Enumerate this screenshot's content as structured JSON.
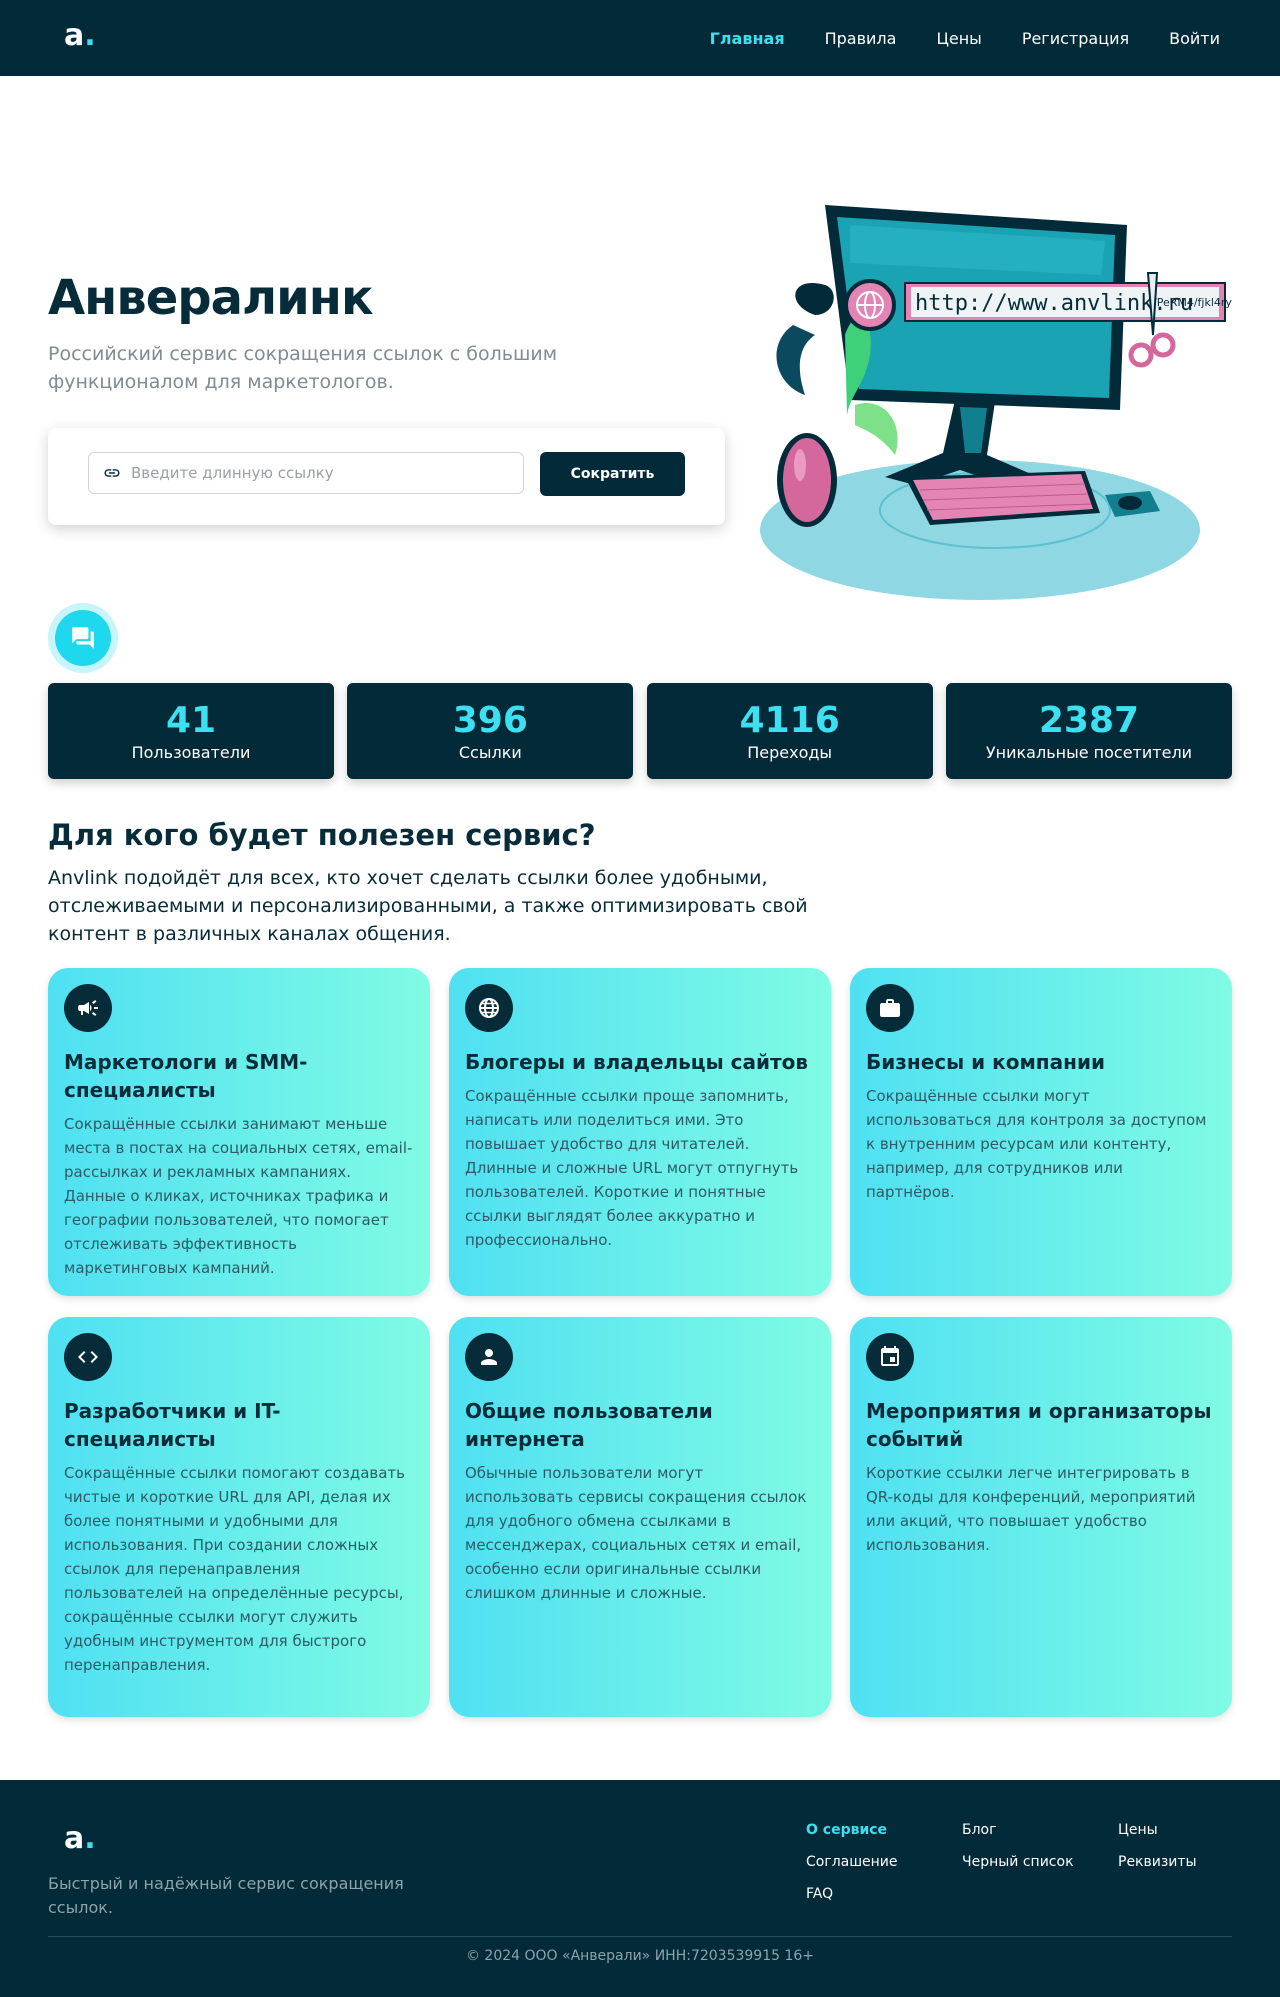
{
  "nav": {
    "logo_letter": "a",
    "logo_dot": ".",
    "links": [
      "Главная",
      "Правила",
      "Цены",
      "Регистрация",
      "Войти"
    ]
  },
  "hero": {
    "title": "Анвералинк",
    "subtitle": "Российский сервис сокращения ссылок с большим функционалом для маркетологов.",
    "input_placeholder": "Введите длинную ссылку",
    "button_label": "Сократить",
    "illustration_url_text": "http://www.anvlink.ru",
    "illustration_url_tail": "/PeRM4/fjkl4ry"
  },
  "stats": [
    {
      "value": "41",
      "label": "Пользователи"
    },
    {
      "value": "396",
      "label": "Ссылки"
    },
    {
      "value": "4116",
      "label": "Переходы"
    },
    {
      "value": "2387",
      "label": "Уникальные посетители"
    }
  ],
  "audience": {
    "title": "Для кого будет полезен сервис?",
    "description": "Anvlink подойдёт для всех, кто хочет сделать ссылки более удобными, отслеживаемыми и персонализированными, а также оптимизировать свой контент в различных каналах общения.",
    "cards": [
      {
        "icon": "megaphone-icon",
        "title": "Маркетологи и SMM-специалисты",
        "text": "Сокращённые ссылки занимают меньше места в постах на социальных сетях, email-рассылках и рекламных кампаниях. Данные о кликах, источниках трафика и географии пользователей, что помогает отслеживать эффективность маркетинговых кампаний."
      },
      {
        "icon": "globe-icon",
        "title": "Блогеры и владельцы сайтов",
        "text": "Сокращённые ссылки проще запомнить, написать или поделиться ими. Это повышает удобство для читателей. Длинные и сложные URL могут отпугнуть пользователей. Короткие и понятные ссылки выглядят более аккуратно и профессионально."
      },
      {
        "icon": "briefcase-icon",
        "title": "Бизнесы и компании",
        "text": "Сокращённые ссылки могут использоваться для контроля за доступом к внутренним ресурсам или контенту, например, для сотрудников или партнёров."
      },
      {
        "icon": "code-icon",
        "title": "Разработчики и IT-специалисты",
        "text": "Сокращённые ссылки помогают создавать чистые и короткие URL для API, делая их более понятными и удобными для использования. При создании сложных ссылок для перенаправления пользователей на определённые ресурсы, сокращённые ссылки могут служить удобным инструментом для быстрого перенаправления."
      },
      {
        "icon": "user-icon",
        "title": "Общие пользователи интернета",
        "text": "Обычные пользователи могут использовать сервисы сокращения ссылок для удобного обмена ссылками в мессенджерах, социальных сетях и email, особенно если оригинальные ссылки слишком длинные и сложные."
      },
      {
        "icon": "calendar-icon",
        "title": "Мероприятия и организаторы событий",
        "text": "Короткие ссылки легче интегрировать в QR-коды для конференций, мероприятий или акций, что повышает удобство использования."
      }
    ]
  },
  "footer": {
    "tagline": "Быстрый и надёжный сервис сокращения ссылок.",
    "links": [
      "О сервисе",
      "Блог",
      "Цены",
      "Соглашение",
      "Черный список",
      "Реквизиты",
      "FAQ"
    ],
    "copyright": "© 2024 ООО «Анверали» ИНН:7203539915 16+"
  },
  "colors": {
    "navy": "#022a38",
    "accent": "#3de0f0",
    "card_gradient_start": "#4fe0f2",
    "card_gradient_end": "#80fbe4"
  }
}
